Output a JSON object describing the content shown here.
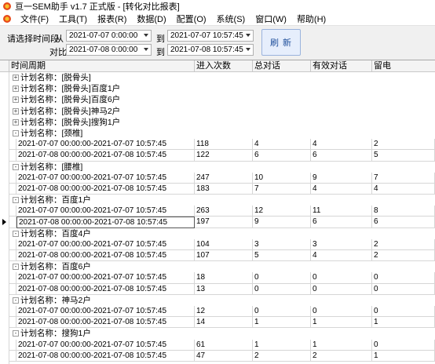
{
  "window": {
    "title": "亘一SEM助手 v1.7 正式版 - [转化对比报表]"
  },
  "menu": [
    "文件(F)",
    "工具(T)",
    "报表(R)",
    "数据(D)",
    "配置(O)",
    "系统(S)",
    "窗口(W)",
    "帮助(H)"
  ],
  "filter": {
    "range_label": "请选择时间段",
    "from_label": "从",
    "compare_label": "对比",
    "to_label": "到",
    "from_start": "2021-07-07  0:00:00",
    "from_end": "2021-07-07 10:57:45",
    "cmp_start": "2021-07-08  0:00:00",
    "cmp_end": "2021-07-08 10:57:45",
    "refresh": "刷 新"
  },
  "table": {
    "headers": [
      "时间周期",
      "进入次数",
      "总对话",
      "有效对话",
      "留电"
    ],
    "rows": [
      {
        "type": "group",
        "expander": "+",
        "label": "计划名称：[脱骨头]"
      },
      {
        "type": "group",
        "expander": "+",
        "label": "计划名称：[脱骨头]百度1户"
      },
      {
        "type": "group",
        "expander": "+",
        "label": "计划名称：[脱骨头]百度6户"
      },
      {
        "type": "group",
        "expander": "+",
        "label": "计划名称：[脱骨头]神马2户"
      },
      {
        "type": "group",
        "expander": "+",
        "label": "计划名称：[脱骨头]搜狗1户"
      },
      {
        "type": "group",
        "expander": "-",
        "label": "计划名称：[颈椎]"
      },
      {
        "type": "data",
        "period": "2021-07-07 00:00:00-2021-07-07 10:57:45",
        "visits": "118",
        "total": "4",
        "valid": "4",
        "phone": "2"
      },
      {
        "type": "data",
        "period": "2021-07-08 00:00:00-2021-07-08 10:57:45",
        "visits": "122",
        "total": "6",
        "valid": "6",
        "phone": "5"
      },
      {
        "type": "group",
        "expander": "-",
        "label": "计划名称：[腰椎]"
      },
      {
        "type": "data",
        "period": "2021-07-07 00:00:00-2021-07-07 10:57:45",
        "visits": "247",
        "total": "10",
        "valid": "9",
        "phone": "7"
      },
      {
        "type": "data",
        "period": "2021-07-08 00:00:00-2021-07-08 10:57:45",
        "visits": "183",
        "total": "7",
        "valid": "4",
        "phone": "4"
      },
      {
        "type": "group",
        "expander": "-",
        "label": "计划名称：百度1户"
      },
      {
        "type": "data",
        "period": "2021-07-07 00:00:00-2021-07-07 10:57:45",
        "visits": "263",
        "total": "12",
        "valid": "11",
        "phone": "8"
      },
      {
        "type": "data",
        "period": "2021-07-08 00:00:00-2021-07-08 10:57:45",
        "visits": "197",
        "total": "9",
        "valid": "6",
        "phone": "6",
        "active": true
      },
      {
        "type": "group",
        "expander": "-",
        "label": "计划名称：百度4户"
      },
      {
        "type": "data",
        "period": "2021-07-07 00:00:00-2021-07-07 10:57:45",
        "visits": "104",
        "total": "3",
        "valid": "3",
        "phone": "2"
      },
      {
        "type": "data",
        "period": "2021-07-08 00:00:00-2021-07-08 10:57:45",
        "visits": "107",
        "total": "5",
        "valid": "4",
        "phone": "2"
      },
      {
        "type": "group",
        "expander": "-",
        "label": "计划名称：百度6户"
      },
      {
        "type": "data",
        "period": "2021-07-07 00:00:00-2021-07-07 10:57:45",
        "visits": "18",
        "total": "0",
        "valid": "0",
        "phone": "0"
      },
      {
        "type": "data",
        "period": "2021-07-08 00:00:00-2021-07-08 10:57:45",
        "visits": "13",
        "total": "0",
        "valid": "0",
        "phone": "0"
      },
      {
        "type": "group",
        "expander": "-",
        "label": "计划名称：神马2户"
      },
      {
        "type": "data",
        "period": "2021-07-07 00:00:00-2021-07-07 10:57:45",
        "visits": "12",
        "total": "0",
        "valid": "0",
        "phone": "0"
      },
      {
        "type": "data",
        "period": "2021-07-08 00:00:00-2021-07-08 10:57:45",
        "visits": "14",
        "total": "1",
        "valid": "1",
        "phone": "1"
      },
      {
        "type": "group",
        "expander": "-",
        "label": "计划名称：搜狗1户"
      },
      {
        "type": "data",
        "period": "2021-07-07 00:00:00-2021-07-07 10:57:45",
        "visits": "61",
        "total": "1",
        "valid": "1",
        "phone": "0"
      },
      {
        "type": "data",
        "period": "2021-07-08 00:00:00-2021-07-08 10:57:45",
        "visits": "47",
        "total": "2",
        "valid": "2",
        "phone": "1"
      }
    ]
  }
}
